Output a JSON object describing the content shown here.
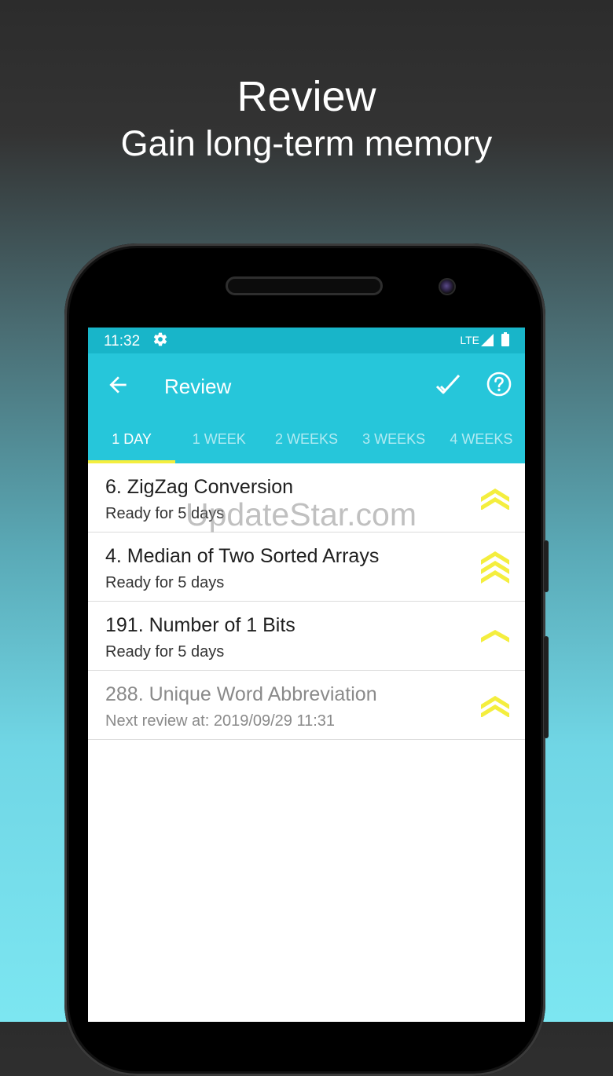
{
  "headline": {
    "title": "Review",
    "subtitle": "Gain long-term memory"
  },
  "status_bar": {
    "time": "11:32",
    "network": "LTE"
  },
  "toolbar": {
    "title": "Review"
  },
  "tabs": [
    {
      "label": "1 DAY",
      "active": true
    },
    {
      "label": "1 WEEK",
      "active": false
    },
    {
      "label": "2 WEEKS",
      "active": false
    },
    {
      "label": "3 WEEKS",
      "active": false
    },
    {
      "label": "4 WEEKS",
      "active": false
    }
  ],
  "items": [
    {
      "title": "6. ZigZag Conversion",
      "subtitle": "Ready for 5 days",
      "level": 2
    },
    {
      "title": "4. Median of Two Sorted Arrays",
      "subtitle": "Ready for 5 days",
      "level": 3
    },
    {
      "title": "191. Number of 1 Bits",
      "subtitle": "Ready for 5 days",
      "level": 1
    },
    {
      "title": "288. Unique Word Abbreviation",
      "subtitle": "Next review at: 2019/09/29 11:31",
      "level": 2
    }
  ],
  "watermark": "UpdateStar.com",
  "colors": {
    "accent": "#26c6da",
    "status_bar": "#18b5c9",
    "tab_indicator": "#f4ee3e",
    "rank_chevron": "#f4ee3e"
  }
}
